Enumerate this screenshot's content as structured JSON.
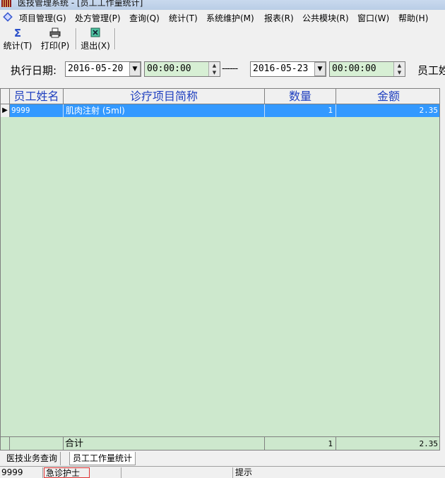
{
  "window": {
    "title": "医技管理系统 - [员工工作量统计]"
  },
  "menu": [
    "项目管理(G)",
    "处方管理(P)",
    "查询(Q)",
    "统计(T)",
    "系统维护(M)",
    "报表(R)",
    "公共模块(R)",
    "窗口(W)",
    "帮助(H)"
  ],
  "toolbar": {
    "stats_label": "统计(T)",
    "print_label": "打印(P)",
    "exit_label": "退出(X)"
  },
  "filter": {
    "date_label": "执行日期:",
    "start_date": "2016-05-20",
    "start_time": "00:00:00",
    "separator": "------",
    "end_date": "2016-05-23",
    "end_time": "00:00:00",
    "employee_label": "员工姓"
  },
  "table": {
    "columns": [
      "员工姓名",
      "诊疗项目简称",
      "数量",
      "金额"
    ],
    "rows": [
      {
        "name": "9999",
        "item": "肌肉注射 (5ml)",
        "qty": "1",
        "amount": "2.35"
      }
    ],
    "footer": {
      "label": "合计",
      "qty": "1",
      "amount": "2.35"
    }
  },
  "tabs": [
    "医技业务查询",
    "员工工作量统计"
  ],
  "status": {
    "user": "9999",
    "role": "急诊护士",
    "empty": "",
    "hint": "提示"
  },
  "colors": {
    "grid_bg": "#cde8cd",
    "selection": "#3399ff",
    "header_text": "#1f3fbf",
    "time_field_bg": "#d7efd4"
  }
}
